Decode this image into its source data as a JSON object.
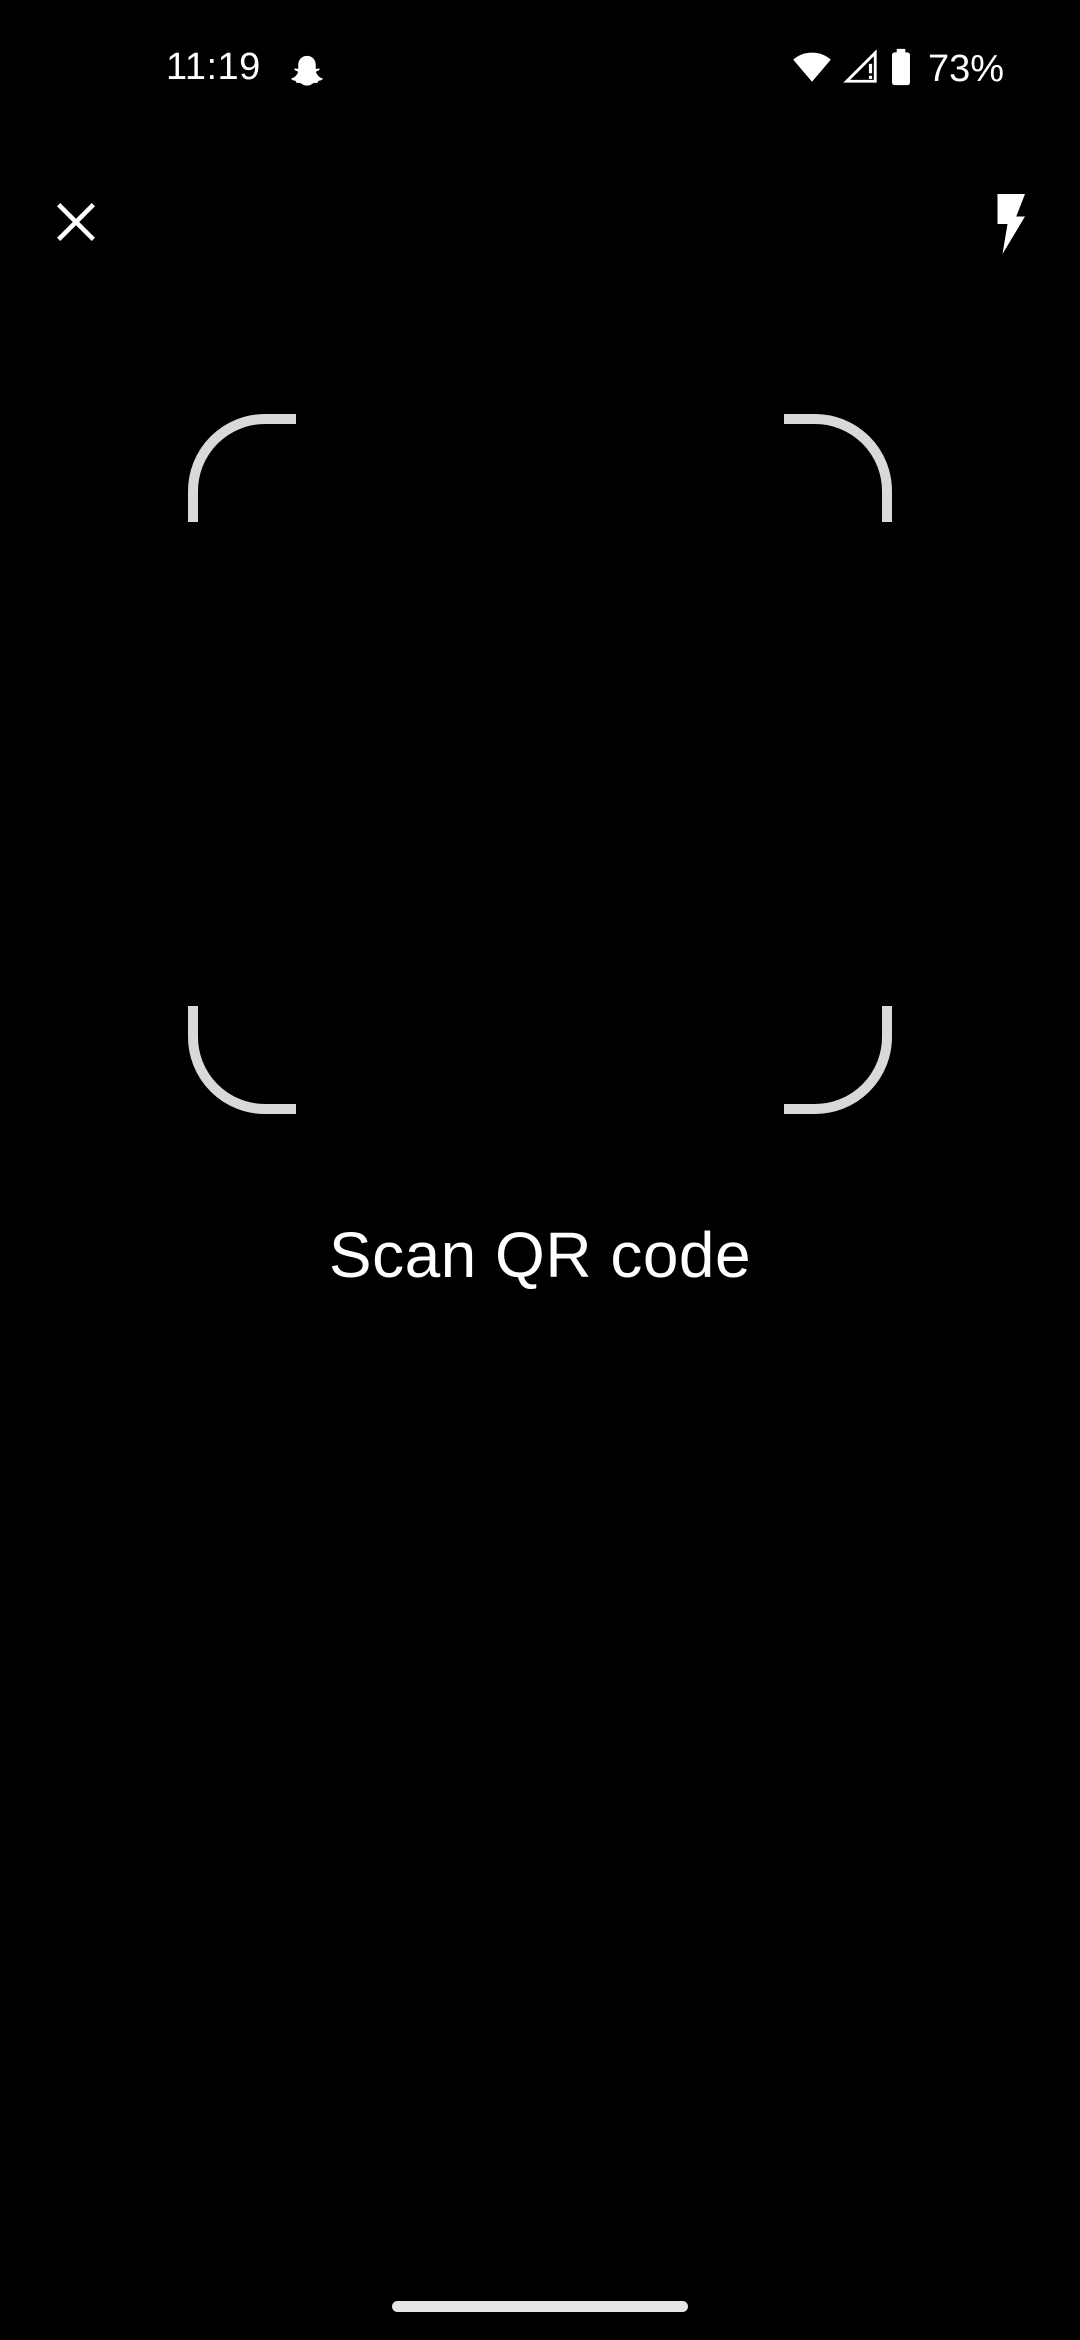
{
  "status_bar": {
    "time": "11:19",
    "notification_icon": "snapchat-ghost-icon",
    "wifi_icon": "wifi-icon",
    "signal_icon": "cellular-signal-no-data-icon",
    "battery_icon": "battery-icon",
    "battery_percent": "73%"
  },
  "toolbar": {
    "close_icon": "close-icon",
    "flash_icon": "flash-icon"
  },
  "scanner": {
    "prompt": "Scan QR code",
    "frame_color": "#d9d9d9"
  },
  "colors": {
    "background": "#000000",
    "text": "#ffffff"
  }
}
